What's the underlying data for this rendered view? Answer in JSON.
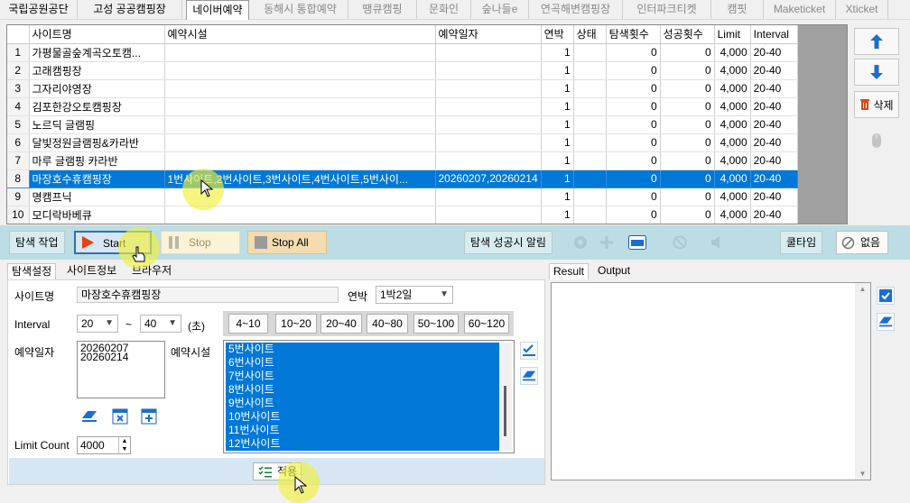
{
  "top_tabs": [
    {
      "label": "국립공원공단",
      "state": "normal"
    },
    {
      "label": "고성 공공캠핑장",
      "state": "normal"
    },
    {
      "label": "네이버예약",
      "state": "active"
    },
    {
      "label": "동해시 통합예약",
      "state": "dim"
    },
    {
      "label": "땡큐캠핑",
      "state": "dim"
    },
    {
      "label": "문화인",
      "state": "dim"
    },
    {
      "label": "숲나들e",
      "state": "dim"
    },
    {
      "label": "연곡해변캠핑장",
      "state": "dim"
    },
    {
      "label": "인터파크티켓",
      "state": "dim"
    },
    {
      "label": "캠핏",
      "state": "dim"
    },
    {
      "label": "Maketicket",
      "state": "dim"
    },
    {
      "label": "Xticket",
      "state": "dim"
    }
  ],
  "grid": {
    "headers": [
      "",
      "사이트명",
      "예약시설",
      "예약일자",
      "연박",
      "상태",
      "탐색횟수",
      "성공횟수",
      "Limit",
      "Interval"
    ],
    "selected_row": 7,
    "rows": [
      [
        "1",
        "가평물골숲계곡오토캠...",
        "",
        "",
        "1",
        "",
        "0",
        "0",
        "4,000",
        "20-40"
      ],
      [
        "2",
        "고래캠핑장",
        "",
        "",
        "1",
        "",
        "0",
        "0",
        "4,000",
        "20-40"
      ],
      [
        "3",
        "그자리야영장",
        "",
        "",
        "1",
        "",
        "0",
        "0",
        "4,000",
        "20-40"
      ],
      [
        "4",
        "김포한강오토캠핑장",
        "",
        "",
        "1",
        "",
        "0",
        "0",
        "4,000",
        "20-40"
      ],
      [
        "5",
        "노르딕 글램핑",
        "",
        "",
        "1",
        "",
        "0",
        "0",
        "4,000",
        "20-40"
      ],
      [
        "6",
        "달빛정원글램핑&카라반",
        "",
        "",
        "1",
        "",
        "0",
        "0",
        "4,000",
        "20-40"
      ],
      [
        "7",
        "마루 글램핑 카라반",
        "",
        "",
        "1",
        "",
        "0",
        "0",
        "4,000",
        "20-40"
      ],
      [
        "8",
        "마장호수휴캠핑장",
        "1번사이트,2번사이트,3번사이트,4번사이트,5번사이...",
        "20260207,20260214",
        "1",
        "",
        "0",
        "0",
        "4,000",
        "20-40"
      ],
      [
        "9",
        "명캠프닉",
        "",
        "",
        "1",
        "",
        "0",
        "0",
        "4,000",
        "20-40"
      ],
      [
        "10",
        "모디락바베큐",
        "",
        "",
        "1",
        "",
        "0",
        "0",
        "4,000",
        "20-40"
      ]
    ]
  },
  "side": {
    "delete_label": "삭제"
  },
  "toolbar": {
    "search_task_label": "탐색 작업",
    "start_label": "Start",
    "stop_label": "Stop",
    "stop_all_label": "Stop All",
    "success_alert_label": "탐색 성공시 알림",
    "cooltime_label": "쿨타임",
    "none_label": "없음"
  },
  "settings_tabs": [
    "탐색설정",
    "사이트정보",
    "브라우저"
  ],
  "settings": {
    "site_name_label": "사이트명",
    "site_name_value": "마장호수휴캠핑장",
    "nights_label": "연박",
    "nights_value": "1박2일",
    "interval_label": "Interval",
    "interval_min": "20",
    "interval_tilde": "~",
    "interval_max": "40",
    "interval_unit": "(초)",
    "ranges": [
      "4~10",
      "10~20",
      "20~40",
      "40~80",
      "50~100",
      "60~120"
    ],
    "date_label": "예약일자",
    "dates": [
      "20260207",
      "20260214"
    ],
    "facility_label": "예약시설",
    "facilities": [
      "5번사이트",
      "6번사이트",
      "7번사이트",
      "8번사이트",
      "9번사이트",
      "10번사이트",
      "11번사이트",
      "12번사이트"
    ],
    "limit_label": "Limit Count",
    "limit_value": "4000",
    "apply_label": "적용"
  },
  "result_tabs": [
    "Result",
    "Output"
  ],
  "colors": {
    "accent": "#0078d7",
    "toolbar_bg": "#bcdde4",
    "start_border": "#2f6fb5",
    "stop_all_bg": "#f4dbb0"
  }
}
